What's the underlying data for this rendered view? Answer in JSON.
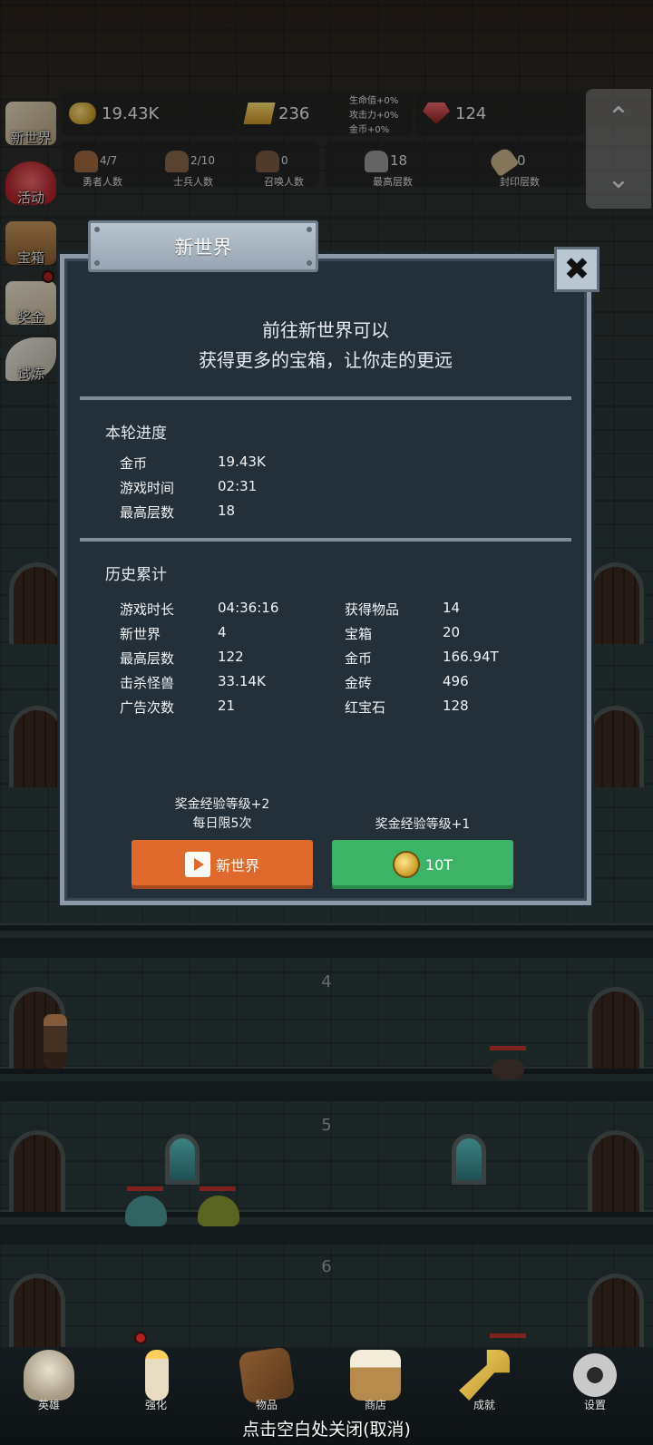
{
  "side_menu": [
    {
      "label": "新世界",
      "icon": "map-icon"
    },
    {
      "label": "活动",
      "icon": "heart-icon"
    },
    {
      "label": "宝箱",
      "icon": "chest-icon"
    },
    {
      "label": "奖金",
      "icon": "envelope-icon"
    },
    {
      "label": "试炼",
      "icon": "feather-icon"
    }
  ],
  "resources": {
    "gold": "19.43K",
    "gold_bar": "236",
    "ruby": "124",
    "buffs": [
      "生命值+0%",
      "攻击力+0%",
      "金币+0%"
    ]
  },
  "stats": {
    "heroes": {
      "value": "4/7",
      "label": "勇者人数"
    },
    "soldiers": {
      "value": "2/10",
      "label": "士兵人数"
    },
    "summons": {
      "value": "0",
      "label": "召唤人数"
    },
    "max_floor": {
      "value": "18",
      "label": "最高层数"
    },
    "sealed_floor": {
      "value": "0",
      "label": "封印层数"
    }
  },
  "scroll": {
    "up": "⌃",
    "down": "⌄"
  },
  "dialog": {
    "title": "新世界",
    "close": "✖",
    "intro_line1": "前往新世界可以",
    "intro_line2": "获得更多的宝箱，让你走的更远",
    "current": {
      "title": "本轮进度",
      "rows": [
        {
          "label": "金币",
          "value": "19.43K"
        },
        {
          "label": "游戏时间",
          "value": "02:31"
        },
        {
          "label": "最高层数",
          "value": "18"
        }
      ]
    },
    "history": {
      "title": "历史累计",
      "left": [
        {
          "label": "游戏时长",
          "value": "04:36:16"
        },
        {
          "label": "新世界",
          "value": "4"
        },
        {
          "label": "最高层数",
          "value": "122"
        },
        {
          "label": "击杀怪兽",
          "value": "33.14K"
        },
        {
          "label": "广告次数",
          "value": "21"
        }
      ],
      "right": [
        {
          "label": "获得物品",
          "value": "14"
        },
        {
          "label": "宝箱",
          "value": "20"
        },
        {
          "label": "金币",
          "value": "166.94T"
        },
        {
          "label": "金砖",
          "value": "496"
        },
        {
          "label": "红宝石",
          "value": "128"
        }
      ]
    },
    "ad_note_line1": "奖金经验等级+2",
    "ad_note_line2": "每日限5次",
    "ad_button": "新世界",
    "coin_note": "奖金经验等级+1",
    "coin_button": "10T"
  },
  "floors": [
    "4",
    "5",
    "6"
  ],
  "bottom_nav": [
    {
      "label": "英雄",
      "icon": "skull-icon"
    },
    {
      "label": "强化",
      "icon": "candle-icon"
    },
    {
      "label": "物品",
      "icon": "book-icon"
    },
    {
      "label": "商店",
      "icon": "mug-icon"
    },
    {
      "label": "成就",
      "icon": "key-icon"
    },
    {
      "label": "设置",
      "icon": "gear-icon"
    }
  ],
  "close_hint": "点击空白处关闭(取消)",
  "colors": {
    "ad_button": "#e06a2c",
    "coin_button": "#3cb467",
    "dialog_bg": "#243039"
  }
}
